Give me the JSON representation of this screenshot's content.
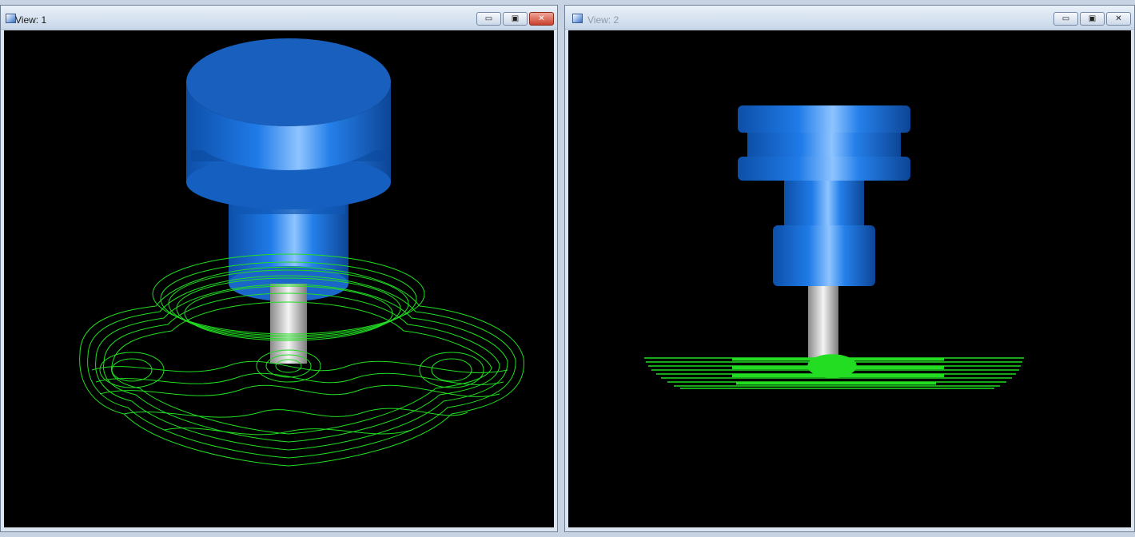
{
  "view1": {
    "title": "View: 1",
    "controls": {
      "minimize": "▭",
      "maximize": "▣",
      "close": "✕"
    }
  },
  "view2": {
    "title": "View: 2",
    "controls": {
      "minimize": "▭",
      "maximize": "▣",
      "close": "✕"
    }
  },
  "colors": {
    "background": "#000000",
    "tool_holder": "#1f78e6",
    "tool_shank": "#c8c8c8",
    "toolpath": "#22dd22"
  },
  "scene_objects": [
    "tool-holder",
    "tool-shank",
    "toolpath-wireframe"
  ]
}
